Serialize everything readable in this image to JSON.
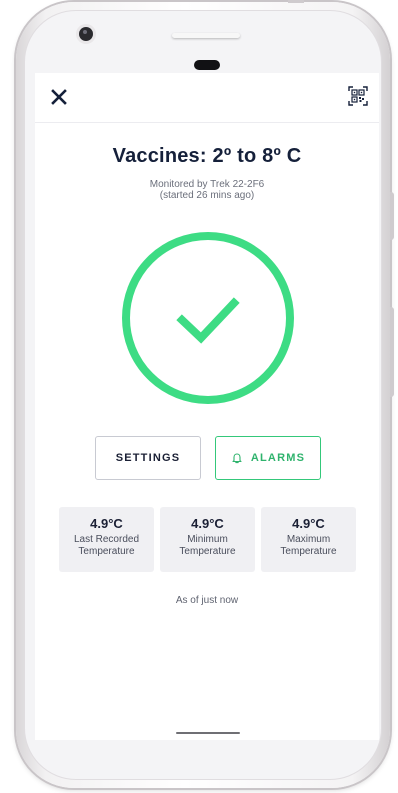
{
  "header": {
    "close_icon": "close-icon",
    "qr_icon": "qr-code-scan-icon"
  },
  "main": {
    "title": "Vaccines: 2º to 8º C",
    "monitor_line": "Monitored by Trek 22-2F6",
    "started_line": "(started 26 mins ago)",
    "status": "ok",
    "status_icon": "check-icon"
  },
  "actions": {
    "settings_label": "SETTINGS",
    "alarms_label": "ALARMS",
    "alarms_icon": "bell-icon"
  },
  "stats": [
    {
      "value": "4.9°C",
      "label_line1": "Last Recorded",
      "label_line2": "Temperature"
    },
    {
      "value": "4.9°C",
      "label_line1": "Minimum",
      "label_line2": "Temperature"
    },
    {
      "value": "4.9°C",
      "label_line1": "Maximum",
      "label_line2": "Temperature"
    }
  ],
  "footer": {
    "as_of": "As of just now"
  },
  "colors": {
    "accent_green": "#3ddc84",
    "title_navy": "#15203a",
    "card_bg": "#f0f0f3"
  }
}
